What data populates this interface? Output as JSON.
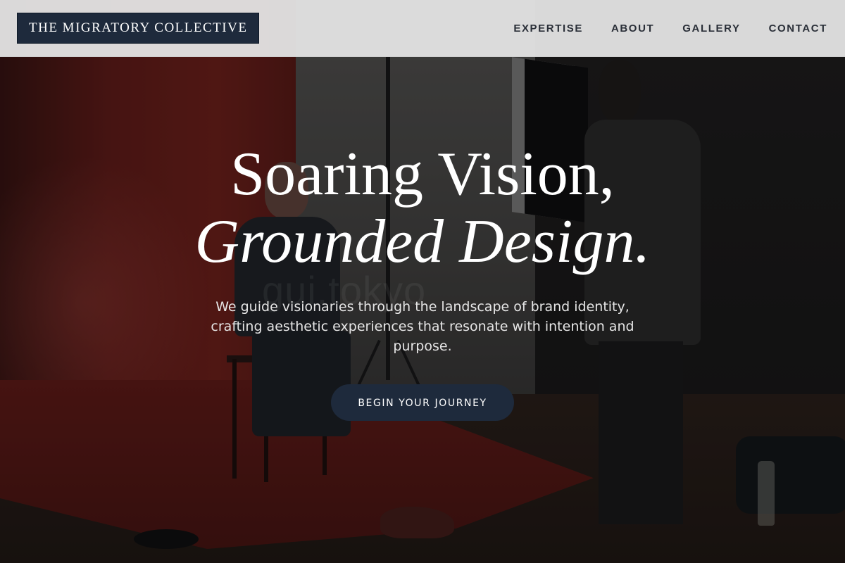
{
  "header": {
    "logo_text": "THE MIGRATORY COLLECTIVE",
    "nav": [
      {
        "label": "EXPERTISE"
      },
      {
        "label": "ABOUT"
      },
      {
        "label": "GALLERY"
      },
      {
        "label": "CONTACT"
      }
    ]
  },
  "hero": {
    "headline_line1": "Soaring Vision,",
    "headline_line2": "Grounded Design.",
    "subtitle": "We guide visionaries through the landscape of brand identity, crafting aesthetic experiences that resonate with intention and purpose.",
    "cta_label": "BEGIN YOUR JOURNEY",
    "background_watermark": "gui.tokyo"
  },
  "colors": {
    "brand_navy": "#1e2a3c",
    "header_bg": "#e2e2e2",
    "nav_text": "#2a2f38",
    "hero_text": "#ffffff"
  }
}
